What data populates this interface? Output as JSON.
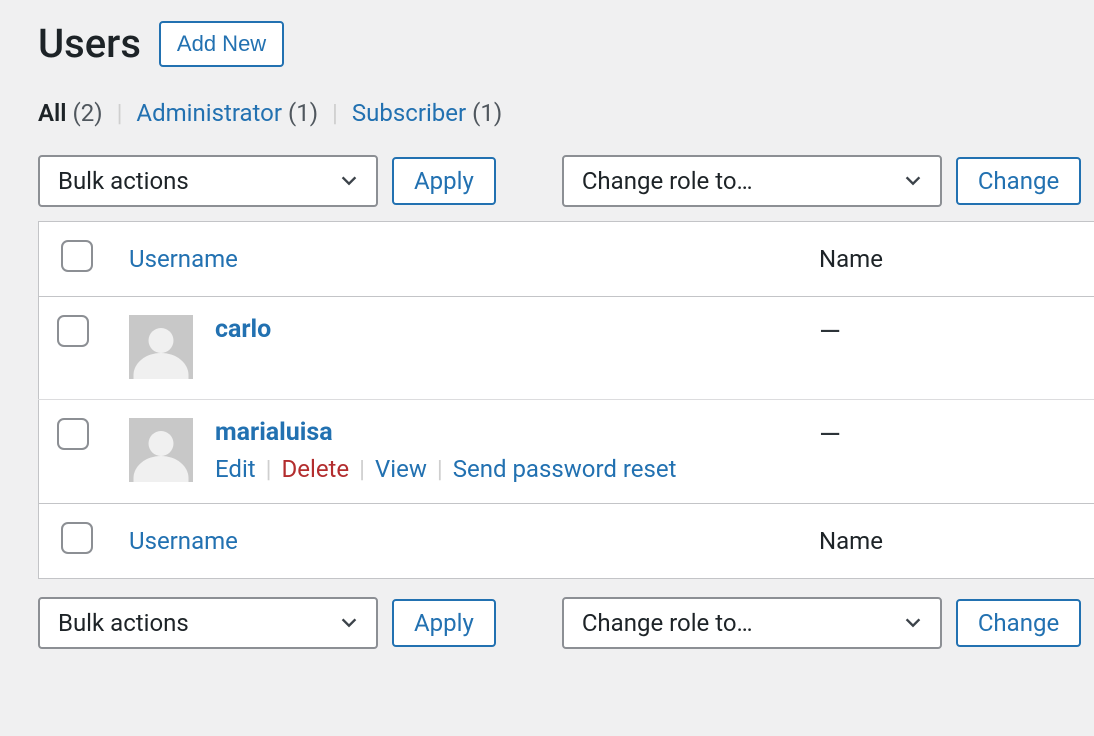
{
  "header": {
    "title": "Users",
    "add_new": "Add New"
  },
  "filters": {
    "all_label": "All",
    "all_count": "(2)",
    "admin_label": "Administrator",
    "admin_count": "(1)",
    "sub_label": "Subscriber",
    "sub_count": "(1)",
    "sep": "|"
  },
  "tablenav": {
    "bulk_label": "Bulk actions",
    "apply_label": "Apply",
    "role_label": "Change role to…",
    "change_label": "Change"
  },
  "table": {
    "col_username": "Username",
    "col_name": "Name"
  },
  "rows": [
    {
      "username": "carlo",
      "name": "—",
      "show_actions": false
    },
    {
      "username": "marialuisa",
      "name": "—",
      "show_actions": true
    }
  ],
  "actions": {
    "edit": "Edit",
    "delete": "Delete",
    "view": "View",
    "send_reset": "Send password reset",
    "sep": "|"
  }
}
